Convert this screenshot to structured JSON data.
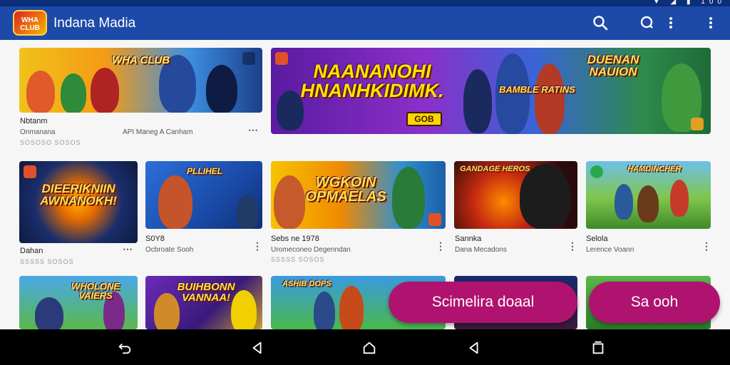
{
  "app": {
    "title": "Indana Madia",
    "logo_text": "WHA CLUB"
  },
  "status": {
    "icons": "▼ ◢ ▮ 100"
  },
  "icons": {
    "search": "search-icon",
    "chat": "chat-icon",
    "overflow": "more-vert-icon"
  },
  "row1": [
    {
      "thumb_title": "WHA CLUB",
      "line1": "Nbtanm",
      "line2": "Onmanana",
      "line2b": "API Maneg A Canham",
      "line3": "SOSOSO SOSOS"
    },
    {
      "thumb_title": "NAANANOHI HNANHKIDIMK.",
      "side_title": "DUENAN NAUION",
      "button_text": "GOB",
      "overlay": "BAMBLE RATINS"
    }
  ],
  "row2": [
    {
      "thumb_title": "DIEERIKNIIN AWNANOKH!",
      "line1": "Dahan",
      "line3": "SSSSS SOSOS"
    },
    {
      "thumb_title": "PLLIHEL",
      "line1": "S0Y8",
      "line2": "Ocbroate Sooh"
    },
    {
      "thumb_title": "WGKOIN OPMAELAS",
      "line1": "Sebs ne 1978",
      "line2": "Uromeconeo Degenndan",
      "line3": "SSSSS SOSOS"
    },
    {
      "thumb_title": "GANDAGE HEROS",
      "line1": "Sannka",
      "line2": "Dana Mecadons"
    },
    {
      "thumb_title": "HAMDINCHER",
      "line1": "Selola",
      "line2": "Lerence Voann"
    }
  ],
  "row3": [
    {
      "thumb_title": "WHOLONE VAIERS"
    },
    {
      "thumb_title": "BUIHBONN VANNAA!"
    },
    {
      "thumb_title": "ASHIB DOPS"
    },
    {
      "thumb_title": ""
    },
    {
      "thumb_title": ""
    }
  ],
  "fabs": {
    "primary": "Scimelira doaal",
    "secondary": "Sa ooh"
  },
  "nav": {
    "back": "back-icon",
    "home": "home-icon",
    "recents": "recents-icon"
  }
}
